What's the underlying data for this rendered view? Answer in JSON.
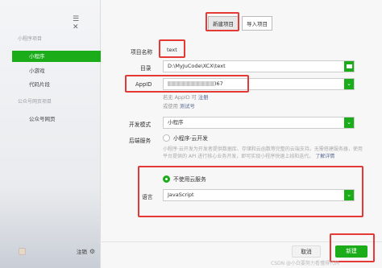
{
  "sidebar": {
    "window_controls": [
      "☰",
      "✕"
    ],
    "section_mini": "小程序项目",
    "items_mini": [
      {
        "label": "小程序",
        "active": true
      },
      {
        "label": "小游戏",
        "active": false
      },
      {
        "label": "代码片段",
        "active": false
      }
    ],
    "section_web": "公众号网页项目",
    "items_web": [
      {
        "label": "公众号网页",
        "active": false
      }
    ],
    "logout_label": "注销"
  },
  "tabs": [
    {
      "label": "新建项目",
      "active": true
    },
    {
      "label": "导入项目",
      "active": false
    }
  ],
  "form": {
    "project_name_label": "项目名称",
    "project_name_value": "text",
    "directory_label": "目录",
    "directory_value": "D:\\MyJuCode\\XCX\\text",
    "appid_label": "AppID",
    "appid_value_suffix": ")67",
    "appid_hint_prefix": "若无 AppID 可",
    "appid_hint_register": "注册",
    "appid_hint_or": "或使用",
    "appid_hint_test": "测试号",
    "dev_mode_label": "开发模式",
    "dev_mode_value": "小程序",
    "backend_label": "后端服务",
    "backend_option_cloud": "小程序·云开发",
    "backend_desc": "小程序·云开发为开发者提供数据库、存储和云函数等完整的云端支持。无需搭建服务器，使用平台提供的 API 进行核心业务开发，即可实现小程序快速上线和迭代。",
    "backend_desc_link": "了解详情",
    "backend_option_nocloud": "不使用云服务",
    "language_label": "语言",
    "language_value": "JavaScript"
  },
  "footer": {
    "cancel_label": "取消",
    "create_label": "新建"
  },
  "watermark": "CSDN @小白要努力看懂得代码",
  "colors": {
    "accent": "#1aad19",
    "annotation_red": "#e53935",
    "link": "#576b95"
  }
}
